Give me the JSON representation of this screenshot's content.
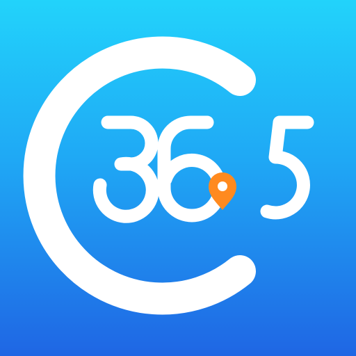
{
  "app_icon": {
    "logo_text": "C365",
    "icon": "map-pin-icon"
  },
  "colors": {
    "background_top": "#22d3fb",
    "background_bottom": "#1f66e4",
    "logo_white": "#ffffff",
    "pin_orange": "#ff8a1f"
  }
}
